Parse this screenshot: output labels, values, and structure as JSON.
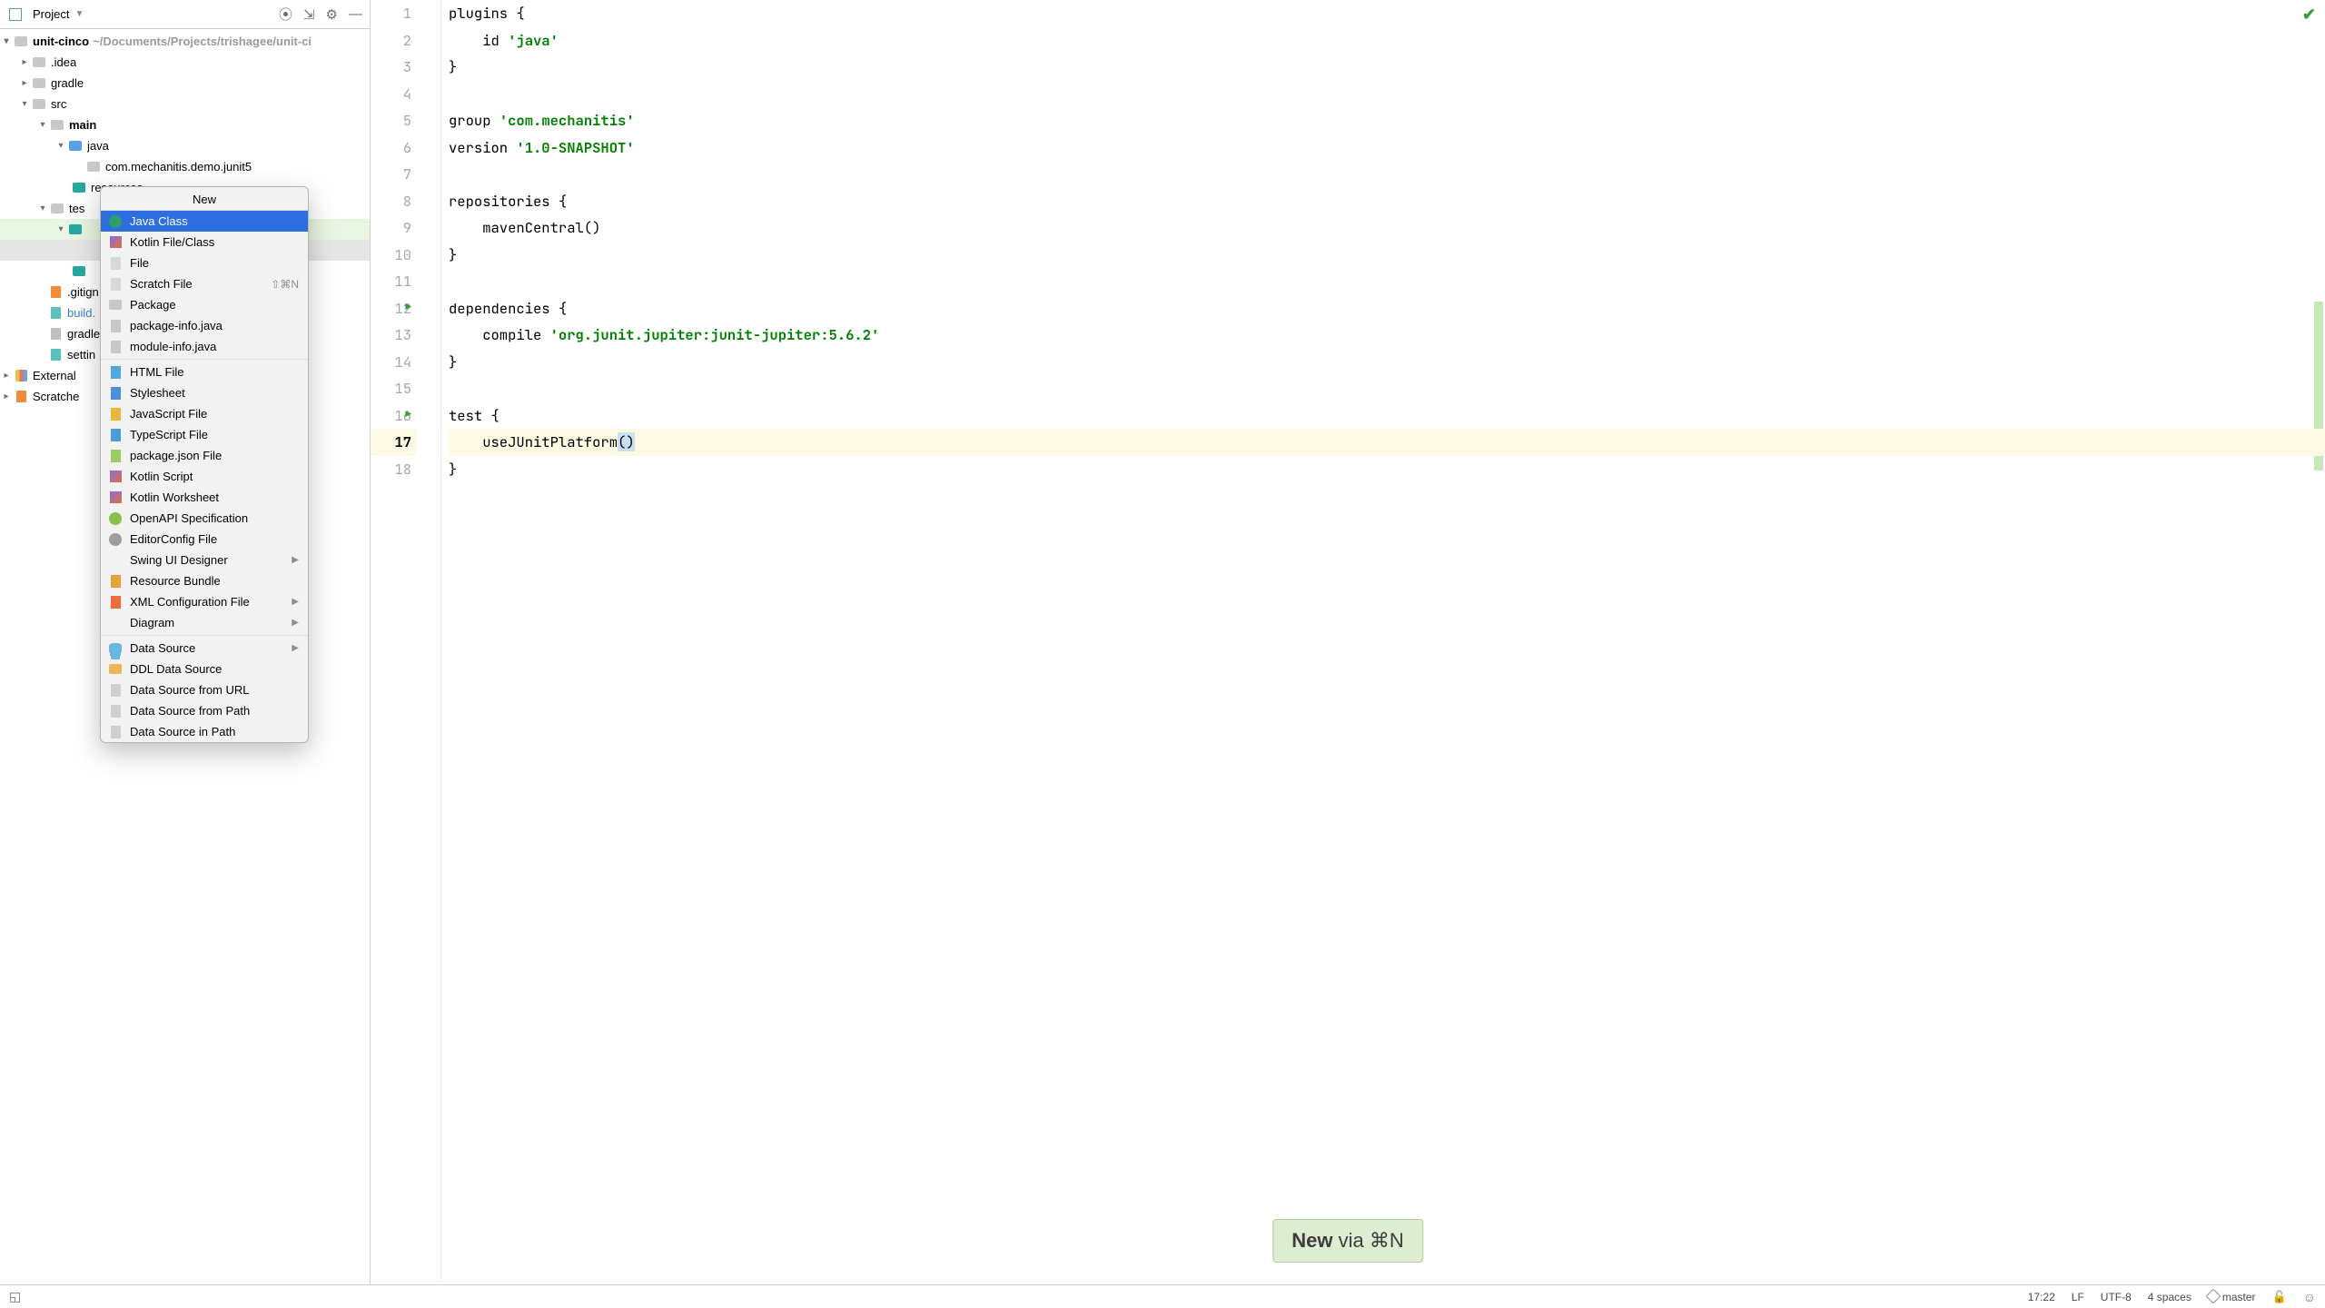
{
  "panel": {
    "title": "Project",
    "tree": {
      "root": "unit-cinco",
      "root_path": "~/Documents/Projects/trishagee/unit-ci",
      "idea": ".idea",
      "gradle": "gradle",
      "src": "src",
      "main": "main",
      "java": "java",
      "pkg": "com.mechanitis.demo.junit5",
      "resources": "resources",
      "test": "tes",
      "gitignore": ".gitign",
      "build": "build.",
      "gradle_props": "gradle",
      "settings": "settin",
      "external": "External",
      "scratches": "Scratche"
    }
  },
  "popup": {
    "title": "New",
    "items": [
      {
        "icon": "mi-class",
        "label": "Java Class",
        "selected": true
      },
      {
        "icon": "mi-kotlin",
        "label": "Kotlin File/Class"
      },
      {
        "icon": "mi-file",
        "label": "File"
      },
      {
        "icon": "mi-file",
        "label": "Scratch File",
        "shortcut": "⇧⌘N"
      },
      {
        "icon": "mi-pkg",
        "label": "Package"
      },
      {
        "icon": "mi-java",
        "label": "package-info.java"
      },
      {
        "icon": "mi-java",
        "label": "module-info.java"
      },
      {
        "sep": true
      },
      {
        "icon": "mi-html",
        "label": "HTML File"
      },
      {
        "icon": "mi-css",
        "label": "Stylesheet"
      },
      {
        "icon": "mi-js",
        "label": "JavaScript File"
      },
      {
        "icon": "mi-ts",
        "label": "TypeScript File"
      },
      {
        "icon": "mi-json",
        "label": "package.json File"
      },
      {
        "icon": "mi-kts",
        "label": "Kotlin Script"
      },
      {
        "icon": "mi-kotlin",
        "label": "Kotlin Worksheet"
      },
      {
        "icon": "mi-openapi",
        "label": "OpenAPI Specification"
      },
      {
        "icon": "mi-editorconfig",
        "label": "EditorConfig File"
      },
      {
        "icon": "",
        "label": "Swing UI Designer",
        "submenu": true
      },
      {
        "icon": "mi-resourcebundle",
        "label": "Resource Bundle"
      },
      {
        "icon": "mi-xml",
        "label": "XML Configuration File",
        "submenu": true
      },
      {
        "icon": "",
        "label": "Diagram",
        "submenu": true
      },
      {
        "sep": true
      },
      {
        "icon": "mi-dbstack",
        "label": "Data Source",
        "submenu": true
      },
      {
        "icon": "mi-ddl",
        "label": "DDL Data Source"
      },
      {
        "icon": "mi-dburl",
        "label": "Data Source from URL"
      },
      {
        "icon": "mi-dbpath",
        "label": "Data Source from Path"
      },
      {
        "icon": "mi-dbin",
        "label": "Data Source in Path"
      }
    ]
  },
  "editor": {
    "lines": [
      {
        "n": 1,
        "t": "plugins {"
      },
      {
        "n": 2,
        "t": "    id 'java'",
        "str": "'java'",
        "pre": "    id "
      },
      {
        "n": 3,
        "t": "}"
      },
      {
        "n": 4,
        "t": ""
      },
      {
        "n": 5,
        "t": "group 'com.mechanitis'",
        "str": "'com.mechanitis'",
        "pre": "group "
      },
      {
        "n": 6,
        "t": "version '1.0-SNAPSHOT'",
        "str": "'1.0-SNAPSHOT'",
        "pre": "version "
      },
      {
        "n": 7,
        "t": ""
      },
      {
        "n": 8,
        "t": "repositories {"
      },
      {
        "n": 9,
        "t": "    mavenCentral()"
      },
      {
        "n": 10,
        "t": "}"
      },
      {
        "n": 11,
        "t": ""
      },
      {
        "n": 12,
        "t": "dependencies {",
        "run": true
      },
      {
        "n": 13,
        "t": "    compile 'org.junit.jupiter:junit-jupiter:5.6.2'",
        "str": "'org.junit.jupiter:junit-jupiter:5.6.2'",
        "pre": "    compile "
      },
      {
        "n": 14,
        "t": "}"
      },
      {
        "n": 15,
        "t": ""
      },
      {
        "n": 16,
        "t": "test {",
        "run": true
      },
      {
        "n": 17,
        "t": "    useJUnitPlatform()",
        "hi": true
      },
      {
        "n": 18,
        "t": "}"
      }
    ]
  },
  "tip": {
    "b": "New",
    "rest": " via ⌘N"
  },
  "status": {
    "time": "17:22",
    "le": "LF",
    "enc": "UTF-8",
    "indent": "4 spaces",
    "branch": "master"
  }
}
